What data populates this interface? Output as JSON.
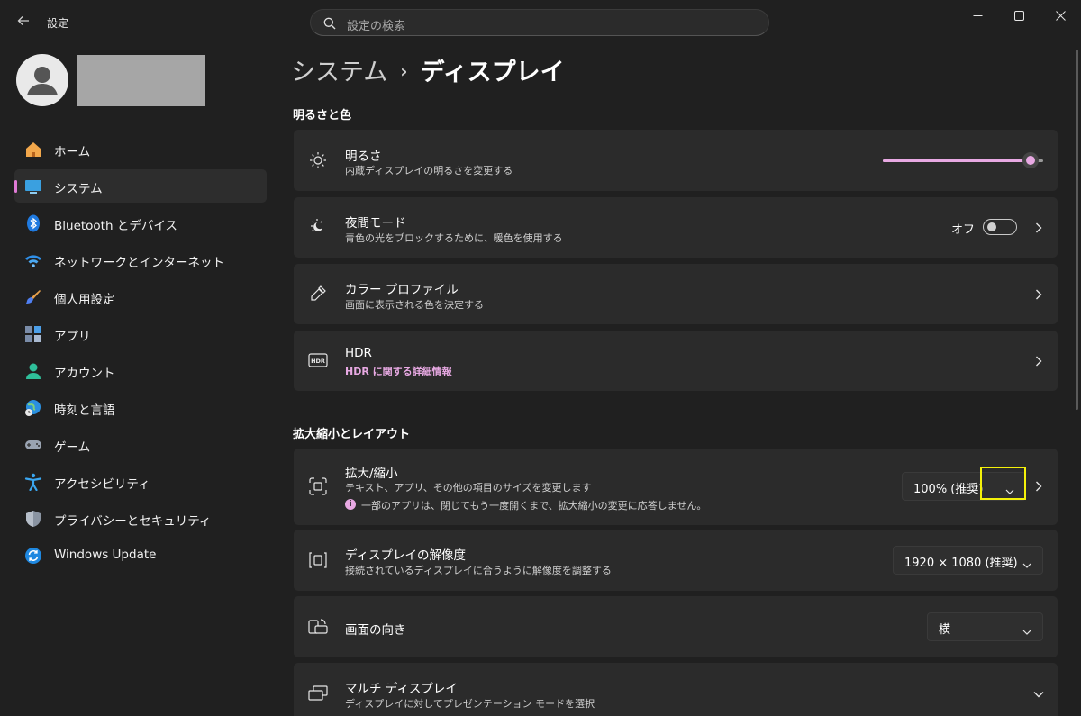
{
  "app": {
    "back_icon": "arrow-left-icon",
    "title": "設定",
    "search_placeholder": "設定の検索",
    "window_controls": [
      "minimize-icon",
      "maximize-icon",
      "close-icon"
    ]
  },
  "user": {
    "avatar_icon": "person-icon",
    "name": ""
  },
  "sidebar": {
    "items": [
      {
        "label": "ホーム",
        "icon": "home-icon",
        "selected": false
      },
      {
        "label": "システム",
        "icon": "monitor-icon",
        "selected": true
      },
      {
        "label": "Bluetooth とデバイス",
        "icon": "bluetooth-icon",
        "selected": false
      },
      {
        "label": "ネットワークとインターネット",
        "icon": "wifi-icon",
        "selected": false
      },
      {
        "label": "個人用設定",
        "icon": "brush-icon",
        "selected": false
      },
      {
        "label": "アプリ",
        "icon": "apps-icon",
        "selected": false
      },
      {
        "label": "アカウント",
        "icon": "account-icon",
        "selected": false
      },
      {
        "label": "時刻と言語",
        "icon": "globe-clock-icon",
        "selected": false
      },
      {
        "label": "ゲーム",
        "icon": "gamepad-icon",
        "selected": false
      },
      {
        "label": "アクセシビリティ",
        "icon": "accessibility-icon",
        "selected": false
      },
      {
        "label": "プライバシーとセキュリティ",
        "icon": "shield-icon",
        "selected": false
      },
      {
        "label": "Windows Update",
        "icon": "update-icon",
        "selected": false
      }
    ]
  },
  "breadcrumb": {
    "parent": "システム",
    "separator": "›",
    "current": "ディスプレイ"
  },
  "sections": {
    "brightness_color": {
      "title": "明るさと色",
      "brightness": {
        "title": "明るさ",
        "subtitle": "内蔵ディスプレイの明るさを変更する",
        "icon": "sun-icon",
        "value_percent": 92
      },
      "night_light": {
        "title": "夜間モード",
        "subtitle": "青色の光をブロックするために、暖色を使用する",
        "icon": "night-light-icon",
        "toggle_label": "オフ",
        "on": false
      },
      "color_profile": {
        "title": "カラー プロファイル",
        "subtitle": "画面に表示される色を決定する",
        "icon": "eyedropper-icon"
      },
      "hdr": {
        "title": "HDR",
        "link": "HDR に関する詳細情報",
        "icon": "hdr-icon"
      }
    },
    "scale_layout": {
      "title": "拡大縮小とレイアウト",
      "scale": {
        "title": "拡大/縮小",
        "subtitle": "テキスト、アプリ、その他の項目のサイズを変更します",
        "notice": "一部のアプリは、閉じてもう一度開くまで、拡大縮小の変更に応答しません。",
        "notice_icon": "info-icon",
        "value": "100% (推奨)",
        "icon": "scale-icon"
      },
      "resolution": {
        "title": "ディスプレイの解像度",
        "subtitle": "接続されているディスプレイに合うように解像度を調整する",
        "value": "1920 × 1080 (推奨)",
        "icon": "resolution-icon"
      },
      "orientation": {
        "title": "画面の向き",
        "value": "横",
        "icon": "orientation-icon"
      },
      "multi_display": {
        "title": "マルチ ディスプレイ",
        "subtitle": "ディスプレイに対してプレゼンテーション モードを選択",
        "icon": "multi-display-icon"
      }
    }
  },
  "colors": {
    "background": "#202020",
    "card": "#2b2b2b",
    "accent": "#e8a9e3",
    "highlight": "#f4f10a"
  }
}
